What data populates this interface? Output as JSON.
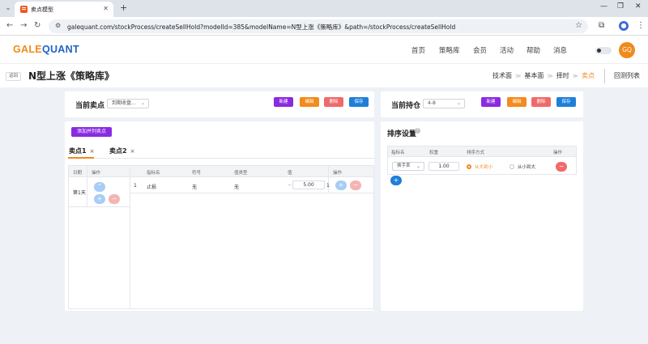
{
  "browser": {
    "tab_title": "卖点模型",
    "url": "galequant.com/stockProcess/createSellHold?modelId=385&modelName=N型上涨《策略库》&path=/stockProcess/createSellHold"
  },
  "header": {
    "logo_part1": "GALE",
    "logo_part2": "QUANT",
    "nav": [
      "首页",
      "策略库",
      "会员",
      "活动",
      "帮助",
      "消息"
    ],
    "avatar": "GQ"
  },
  "titlebar": {
    "back": "返回",
    "title": "N型上涨《策略库》",
    "crumbs": [
      "技术面",
      "基本面",
      "择时",
      "卖点"
    ],
    "backtest_list": "回测列表"
  },
  "sell_panel": {
    "title": "当前卖点",
    "select_value": "到期收盘...",
    "buttons": [
      "新建",
      "编辑",
      "删除",
      "保存"
    ],
    "add_button": "添加并列卖点",
    "tabs": [
      {
        "label": "卖点1",
        "close": "×"
      },
      {
        "label": "卖点2",
        "close": "×"
      }
    ],
    "left_headers": [
      "日期",
      "操作"
    ],
    "day_label": "第1天",
    "headers": [
      "指标名",
      "符号",
      "值类型",
      "值",
      "操作"
    ],
    "row": {
      "index": "1",
      "indicator": "止损",
      "symbol": "无",
      "value_type": "无",
      "value": "5.00",
      "trail": "1"
    }
  },
  "hold_panel": {
    "title": "当前持仓",
    "select_value": "4-8",
    "buttons": [
      "新建",
      "编辑",
      "删除",
      "保存"
    ]
  },
  "sort_panel": {
    "title": "排序设置",
    "headers": [
      "指标名",
      "权重",
      "排序方式",
      "操作"
    ],
    "row": {
      "indicator": "换手率",
      "weight": "1.00",
      "options": [
        "从大到小",
        "从小到大"
      ],
      "selected": "从大到小"
    }
  },
  "colors": {
    "accent": "#f08a1c",
    "brand_blue": "#1e63c9",
    "purple": "#8a2be2",
    "orange": "#f38b1e",
    "red": "#f06a6a",
    "blue": "#1f7fd8"
  }
}
